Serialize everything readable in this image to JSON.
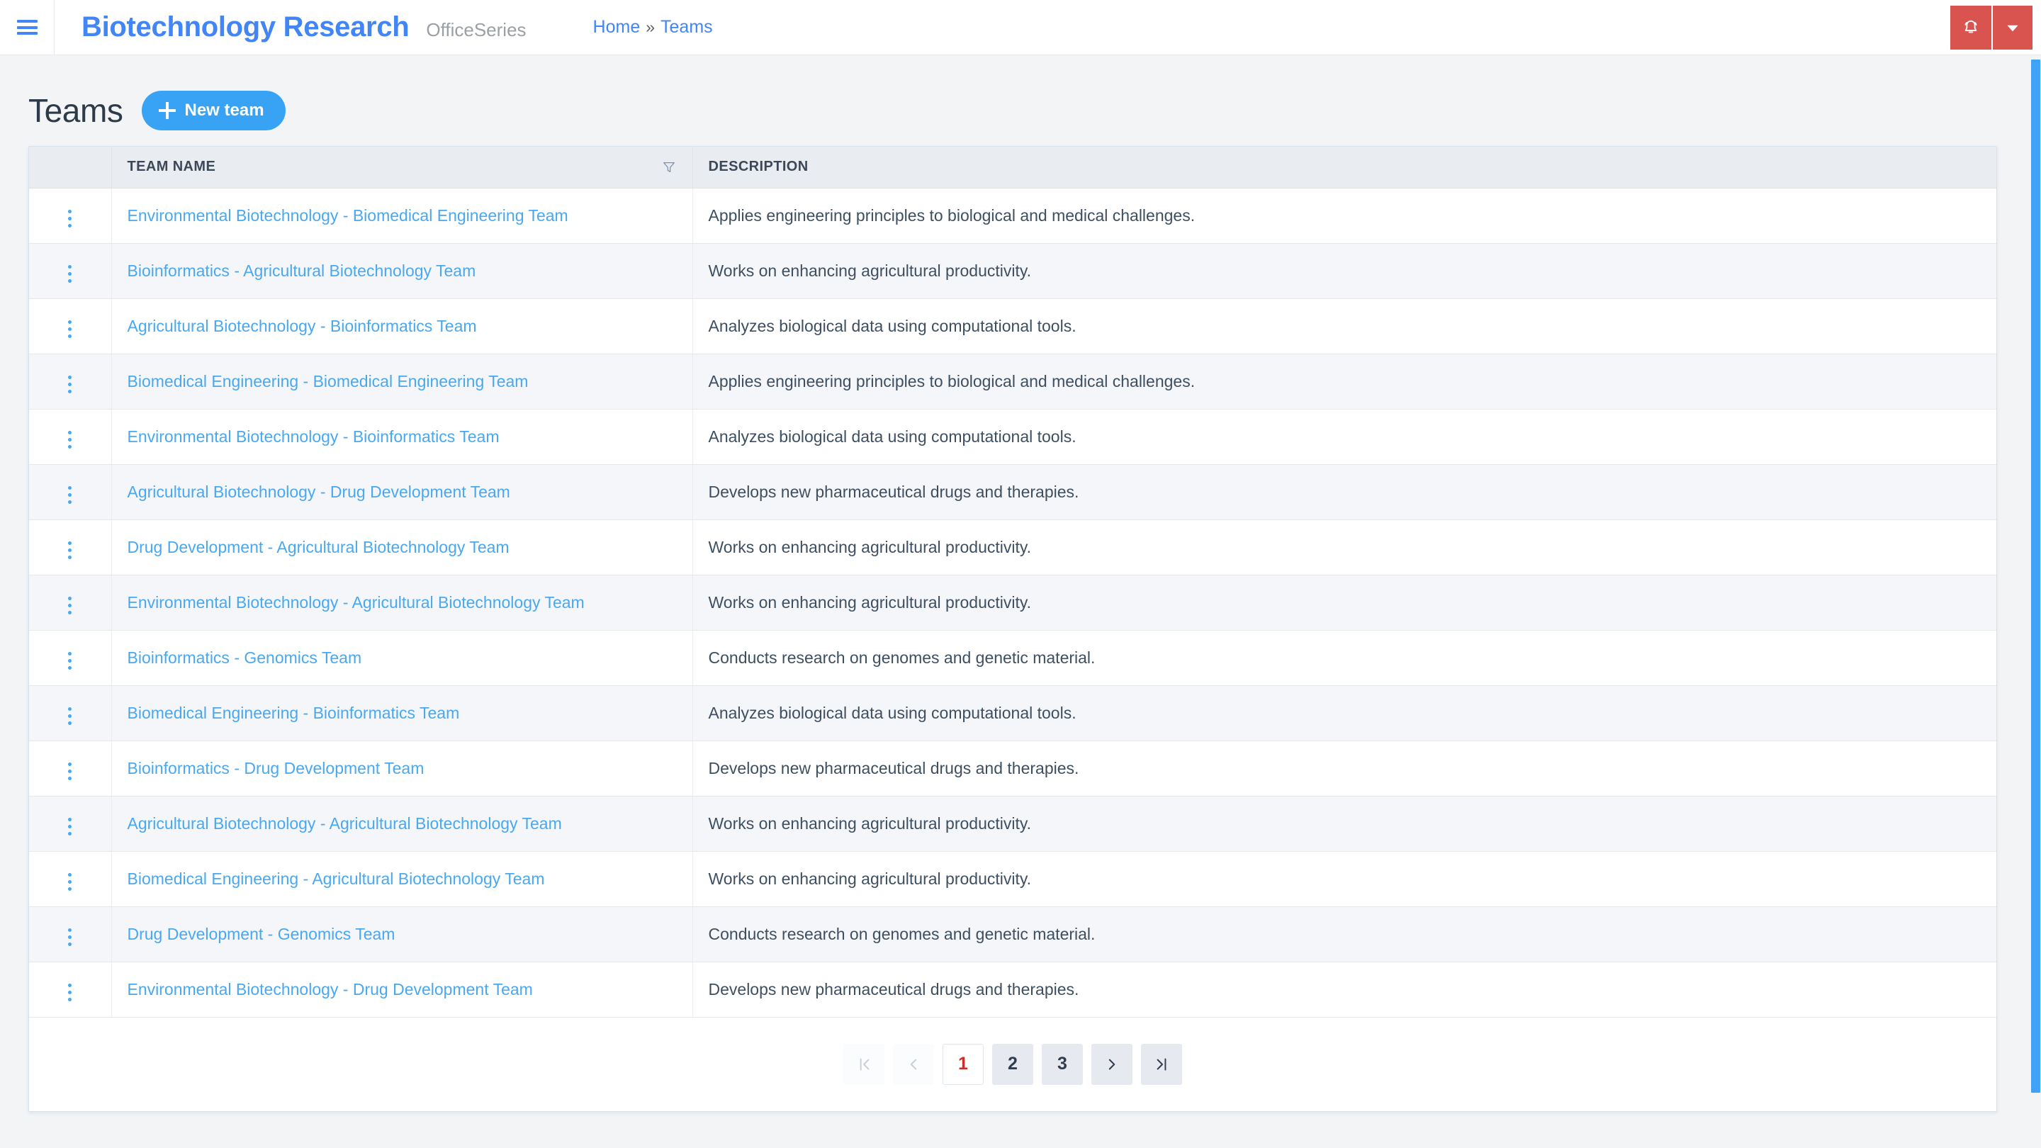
{
  "navbar": {
    "menu_icon": "hamburger-icon",
    "brand_title": "Biotechnology Research",
    "brand_subtitle": "OfficeSeries",
    "breadcrumb": {
      "home": "Home",
      "separator": "»",
      "current": "Teams"
    },
    "actions": {
      "notification_icon": "bell-icon",
      "dropdown_icon": "chevron-down-icon",
      "accent_color": "#d9534f"
    }
  },
  "page": {
    "title": "Teams",
    "new_button_label": "New team",
    "new_button_icon": "plus-icon",
    "accent_color": "#38a3f5"
  },
  "table": {
    "columns": [
      {
        "key": "menu",
        "label": ""
      },
      {
        "key": "name",
        "label": "TEAM NAME",
        "filter_icon": "filter-icon"
      },
      {
        "key": "description",
        "label": "DESCRIPTION"
      }
    ],
    "rows": [
      {
        "name": "Environmental Biotechnology - Biomedical Engineering Team",
        "description": "Applies engineering principles to biological and medical challenges."
      },
      {
        "name": "Bioinformatics - Agricultural Biotechnology Team",
        "description": "Works on enhancing agricultural productivity."
      },
      {
        "name": "Agricultural Biotechnology - Bioinformatics Team",
        "description": "Analyzes biological data using computational tools."
      },
      {
        "name": "Biomedical Engineering - Biomedical Engineering Team",
        "description": "Applies engineering principles to biological and medical challenges."
      },
      {
        "name": "Environmental Biotechnology - Bioinformatics Team",
        "description": "Analyzes biological data using computational tools."
      },
      {
        "name": "Agricultural Biotechnology - Drug Development Team",
        "description": "Develops new pharmaceutical drugs and therapies."
      },
      {
        "name": "Drug Development - Agricultural Biotechnology Team",
        "description": "Works on enhancing agricultural productivity."
      },
      {
        "name": "Environmental Biotechnology - Agricultural Biotechnology Team",
        "description": "Works on enhancing agricultural productivity."
      },
      {
        "name": "Bioinformatics - Genomics Team",
        "description": "Conducts research on genomes and genetic material."
      },
      {
        "name": "Biomedical Engineering - Bioinformatics Team",
        "description": "Analyzes biological data using computational tools."
      },
      {
        "name": "Bioinformatics - Drug Development Team",
        "description": "Develops new pharmaceutical drugs and therapies."
      },
      {
        "name": "Agricultural Biotechnology - Agricultural Biotechnology Team",
        "description": "Works on enhancing agricultural productivity."
      },
      {
        "name": "Biomedical Engineering - Agricultural Biotechnology Team",
        "description": "Works on enhancing agricultural productivity."
      },
      {
        "name": "Drug Development - Genomics Team",
        "description": "Conducts research on genomes and genetic material."
      },
      {
        "name": "Environmental Biotechnology - Drug Development Team",
        "description": "Develops new pharmaceutical drugs and therapies."
      }
    ],
    "row_menu_icon": "kebab-menu-icon"
  },
  "pagination": {
    "first_label": "|‹",
    "prev_label": "‹",
    "pages": [
      "1",
      "2",
      "3"
    ],
    "current_page": "1",
    "next_label": "›",
    "last_label": "›|",
    "active_color": "#c9302c"
  },
  "scrollbar": {
    "name": "vertical-scrollbar",
    "thumb_color": "#3fa2f7"
  }
}
